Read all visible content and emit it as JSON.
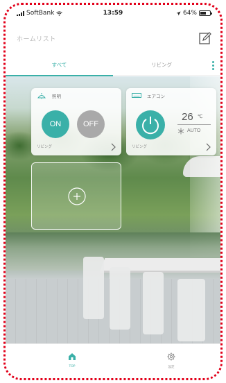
{
  "status_bar": {
    "carrier": "SoftBank",
    "time": "13:59",
    "battery": "64%"
  },
  "header": {
    "title": "ホームリスト"
  },
  "tabs": [
    {
      "label": "すべて",
      "selected": true
    },
    {
      "label": "リビング",
      "selected": false
    }
  ],
  "devices": {
    "light": {
      "name": "照明",
      "on_label": "ON",
      "off_label": "OFF",
      "room": "リビング"
    },
    "aircon": {
      "name": "エアコン",
      "temperature": "26",
      "unit": "℃",
      "mode": "AUTO",
      "room": "リビング"
    }
  },
  "bottom_nav": [
    {
      "label": "TOP",
      "icon": "home-icon",
      "selected": true
    },
    {
      "label": "設定",
      "icon": "gear-icon",
      "selected": false
    }
  ],
  "colors": {
    "accent": "#3ab0a8",
    "off_button": "#a9a9a9",
    "annotation_border": "#e2001a"
  }
}
